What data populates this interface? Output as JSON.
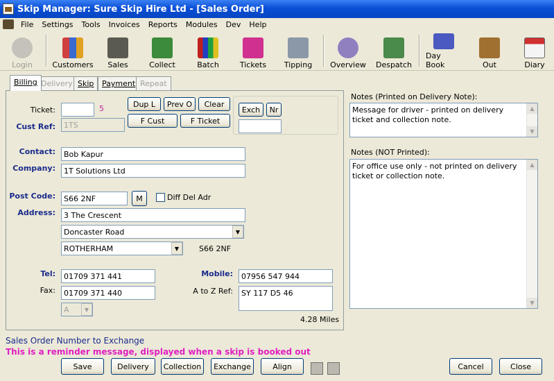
{
  "window": {
    "title": "Skip Manager: Sure Skip Hire Ltd - [Sales Order]"
  },
  "menu": [
    "File",
    "Settings",
    "Tools",
    "Invoices",
    "Reports",
    "Modules",
    "Dev",
    "Help"
  ],
  "toolbar": {
    "login": "Login",
    "customers": "Customers",
    "sales": "Sales",
    "collect": "Collect",
    "batch": "Batch",
    "tickets": "Tickets",
    "tipping": "Tipping",
    "overview": "Overview",
    "despatch": "Despatch",
    "day_book": "Day Book",
    "out": "Out",
    "diary": "Diary"
  },
  "tabs": {
    "billing": "Billing",
    "delivery": "Delivery",
    "skip": "Skip",
    "payment": "Payment",
    "repeat": "Repeat"
  },
  "form": {
    "ticket_label": "Ticket:",
    "ticket_value": "",
    "ticket_count": "5",
    "cust_ref_label": "Cust Ref:",
    "cust_ref_value": "1TS",
    "dup_l": "Dup L",
    "prev_o": "Prev O",
    "clear": "Clear",
    "f_cust": "F Cust",
    "f_ticket": "F Ticket",
    "exch": "Exch",
    "nr": "Nr",
    "exch_value": "",
    "contact_label": "Contact:",
    "contact_value": "Bob Kapur",
    "company_label": "Company:",
    "company_value": "1T Solutions Ltd",
    "postcode_label": "Post Code:",
    "postcode_value": "S66 2NF",
    "m_button": "M",
    "diff_del_adr": "Diff Del Adr",
    "address_label": "Address:",
    "address1": "3 The Crescent",
    "address2": "Doncaster Road",
    "address3": "ROTHERHAM",
    "postcode_display": "S66 2NF",
    "tel_label": "Tel:",
    "tel_value": "01709 371 441",
    "fax_label": "Fax:",
    "fax_value": "01709 371 440",
    "title_select": "A",
    "mobile_label": "Mobile:",
    "mobile_value": "07956 547 944",
    "atoz_label": "A to Z Ref:",
    "atoz_value": "SY 117 D5 46",
    "miles": "4.28 Miles"
  },
  "notes": {
    "printed_label": "Notes (Printed on Delivery Note):",
    "printed_value": "Message for driver - printed on delivery ticket and collection note.",
    "not_printed_label": "Notes (NOT Printed):",
    "not_printed_value": "For office use only - not printed on delivery ticket or collection note."
  },
  "status": {
    "message1": "Sales Order Number to Exchange",
    "message2": "This is a reminder message, displayed when a skip is booked out"
  },
  "buttons": {
    "save": "Save",
    "delivery": "Delivery",
    "collection": "Collection",
    "exchange": "Exchange",
    "align": "Align",
    "cancel": "Cancel",
    "close": "Close"
  },
  "colors": {
    "title_bar": "#0a4fd6",
    "label_blue": "#1a2b8c",
    "reminder": "#e020c0",
    "status_blue": "#1a2b8c"
  }
}
